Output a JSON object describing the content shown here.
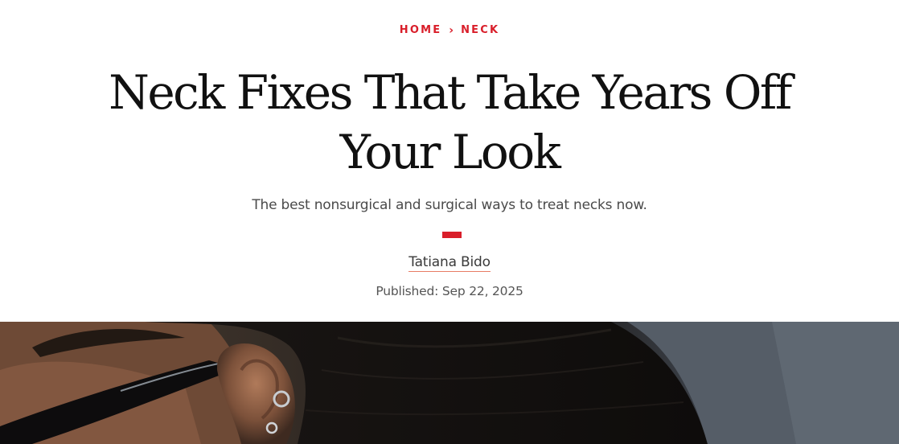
{
  "breadcrumb": {
    "items": [
      {
        "label": "HOME"
      },
      {
        "label": "NECK"
      }
    ],
    "separator": "›"
  },
  "article": {
    "headline_line1": "Neck Fixes That Take Years Off",
    "headline_line2": "Your Look",
    "subtitle": "The best nonsurgical and surgical ways to treat necks now.",
    "author": "Tatiana Bido",
    "published": "Published: Sep 22, 2025"
  },
  "hero": {
    "alt": "woman-profile-with-sunglasses-and-ear-piercings"
  },
  "colors": {
    "accent": "#d91e2a",
    "author_underline": "#e87c64",
    "headline": "#111111",
    "subtitle": "#4a4a4a"
  }
}
